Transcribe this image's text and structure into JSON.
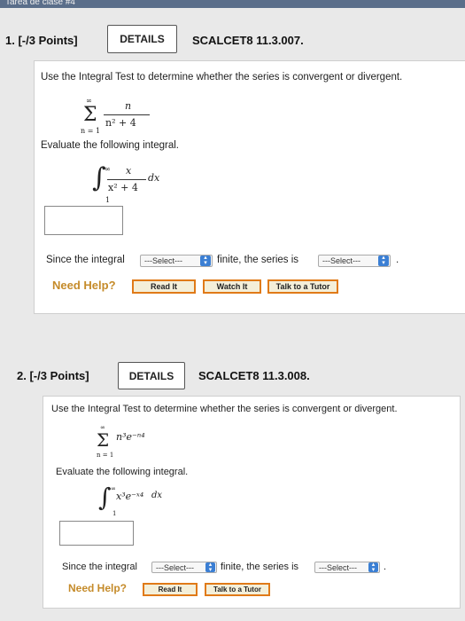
{
  "tab": {
    "label": "Tarea de clase #4"
  },
  "questions": [
    {
      "header": "1. [-/3 Points]",
      "details_label": "DETAILS",
      "code": "SCALCET8 11.3.007.",
      "instruction": "Use the Integral Test to determine whether the series is convergent or divergent.",
      "series": {
        "upper": "∞",
        "lower": "n = 1",
        "numerator": "n",
        "denominator": "n² + 4"
      },
      "evaluate_label": "Evaluate the following integral.",
      "integral": {
        "upper": "∞",
        "lower": "1",
        "numerator": "x",
        "denominator": "x² + 4",
        "dx": "dx"
      },
      "since_label": "Since the integral",
      "select1": "---Select---",
      "finite_label": "finite, the series is",
      "select2": "---Select---",
      "period": ".",
      "need_help": "Need Help?",
      "help_buttons": [
        "Read It",
        "Watch It",
        "Talk to a Tutor"
      ]
    },
    {
      "header": "2. [-/3 Points]",
      "details_label": "DETAILS",
      "code": "SCALCET8 11.3.008.",
      "instruction": "Use the Integral Test to determine whether the series is convergent or divergent.",
      "series": {
        "upper": "∞",
        "lower": "n = 1",
        "term": "n³e⁻ⁿ⁴"
      },
      "evaluate_label": "Evaluate the following integral.",
      "integral": {
        "upper": "∞",
        "lower": "1",
        "term": "x³e⁻ˣ⁴",
        "dx": "dx"
      },
      "since_label": "Since the integral",
      "select1": "---Select---",
      "finite_label": "finite, the series is",
      "select2": "---Select---",
      "period": ".",
      "need_help": "Need Help?",
      "help_buttons": [
        "Read It",
        "Talk to a Tutor"
      ]
    }
  ],
  "colors": {
    "accent_orange": "#e07a18",
    "help_text": "#c58b2a",
    "select_arrow": "#3b7fd4"
  }
}
